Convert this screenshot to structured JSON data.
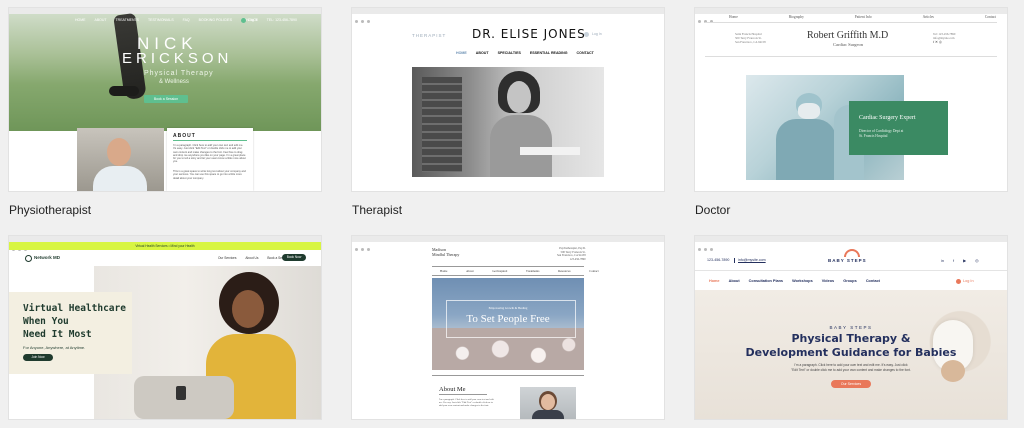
{
  "cards": {
    "physio": {
      "caption": "Physiotherapist",
      "nav": [
        "HOME",
        "ABOUT",
        "TREATMENTS",
        "TESTIMONIALS",
        "FAQ",
        "BOOKING POLICIES",
        "CONTACT",
        "TEL: 123-456-7890"
      ],
      "login": "Log In",
      "hero_title_1": "NICK",
      "hero_title_2": "ERICKSON",
      "hero_sub_1": "Physical Therapy",
      "hero_sub_2": "& Wellness",
      "hero_btn": "Book a Session",
      "about_heading": "ABOUT",
      "about_p1": "I'm a paragraph. Click here to add your own text and edit me. It's easy. Just click \"Edit Text\" or double click me to add your own content and make changes to the font. Feel free to drag and drop me anywhere you like on your page. I'm a great place for you to tell a story and let your users know a little more about you.",
      "about_p2": "This is a great space to write long text about your company and your services. You can use this space to go into a little more detail about your company."
    },
    "therapist": {
      "caption": "Therapist",
      "side_label": "THERAPIST",
      "title": "DR. ELISE JONES",
      "login": "Log In",
      "nav": [
        "HOME",
        "ABOUT",
        "SPECIALTIES",
        "ESSENTIAL READING",
        "CONTACT"
      ]
    },
    "doctor": {
      "caption": "Doctor",
      "nav": [
        "Home",
        "Biography",
        "Patient Info",
        "Articles",
        "Contact"
      ],
      "address": [
        "Saint Francis Hospital",
        "500 Terry Francois St.",
        "San Francisco, CA 94158"
      ],
      "name": "Robert Griffith M.D",
      "role": "Cardiac Surgeon",
      "phone": "Tel: 123-456-7890",
      "email": "info@mysite.com",
      "box_title": "Cardiac Surgery Expert",
      "box_text_1": "Director of Cardiology Dept at",
      "box_text_2": "St. Francis Hospital"
    },
    "network": {
      "banner": "Virtual Health Services • Mind your Health",
      "logo": "Network MD",
      "nav": [
        "Our Services",
        "About Us",
        "Book a Session"
      ],
      "nav_btn": "Book Now",
      "headline_1": "Virtual Healthcare",
      "headline_2": "When You",
      "headline_3": "Need It Most",
      "sub": "For Anyone, Anywhere, at Anytime.",
      "cta": "Join Now"
    },
    "mindful": {
      "brand_1": "Madison",
      "brand_2": "Mindful Therapy",
      "contact": [
        "Psychotherapist, Psy.D.",
        "500 Terry Francois St.",
        "San Francisco, CA 94158",
        "123-456-7890"
      ],
      "nav": [
        "Home",
        "About",
        "Get Inspired",
        "Treatments",
        "Resources",
        "Contact"
      ],
      "hero_small": "Empowering Growth & Healing",
      "hero_title": "To Set People Free",
      "about_title": "About Me",
      "about_text": "I'm a paragraph. Click here to add your own text and edit me. It's easy. Just click \"Edit Text\" or double click me to add your own content and make changes to the font."
    },
    "baby": {
      "phone": "123-456-7890",
      "email": "info@mysite.com",
      "logo": "BABY STEPS",
      "social": [
        "in",
        "f",
        "▶",
        "◎"
      ],
      "nav": [
        "Home",
        "About",
        "Consultation Plans",
        "Workshops",
        "Videos",
        "Groups",
        "Contact"
      ],
      "login": "Log In",
      "eyebrow": "BABY STEPS",
      "title_1": "Physical Therapy &",
      "title_2": "Development Guidance for Babies",
      "body_1": "I'm a paragraph. Click here to add your own text and edit me. It's easy. Just click",
      "body_2": "\"Edit Text\" or double click me to add your own content and make changes to the font.",
      "cta": "Our Services"
    }
  },
  "colors": {
    "physio_green": "#5fbf8f",
    "doctor_green": "#3b8a63",
    "network_lime": "#d8f542",
    "network_dark": "#1f3b2e",
    "baby_orange": "#e9785a",
    "baby_navy": "#24305e"
  }
}
